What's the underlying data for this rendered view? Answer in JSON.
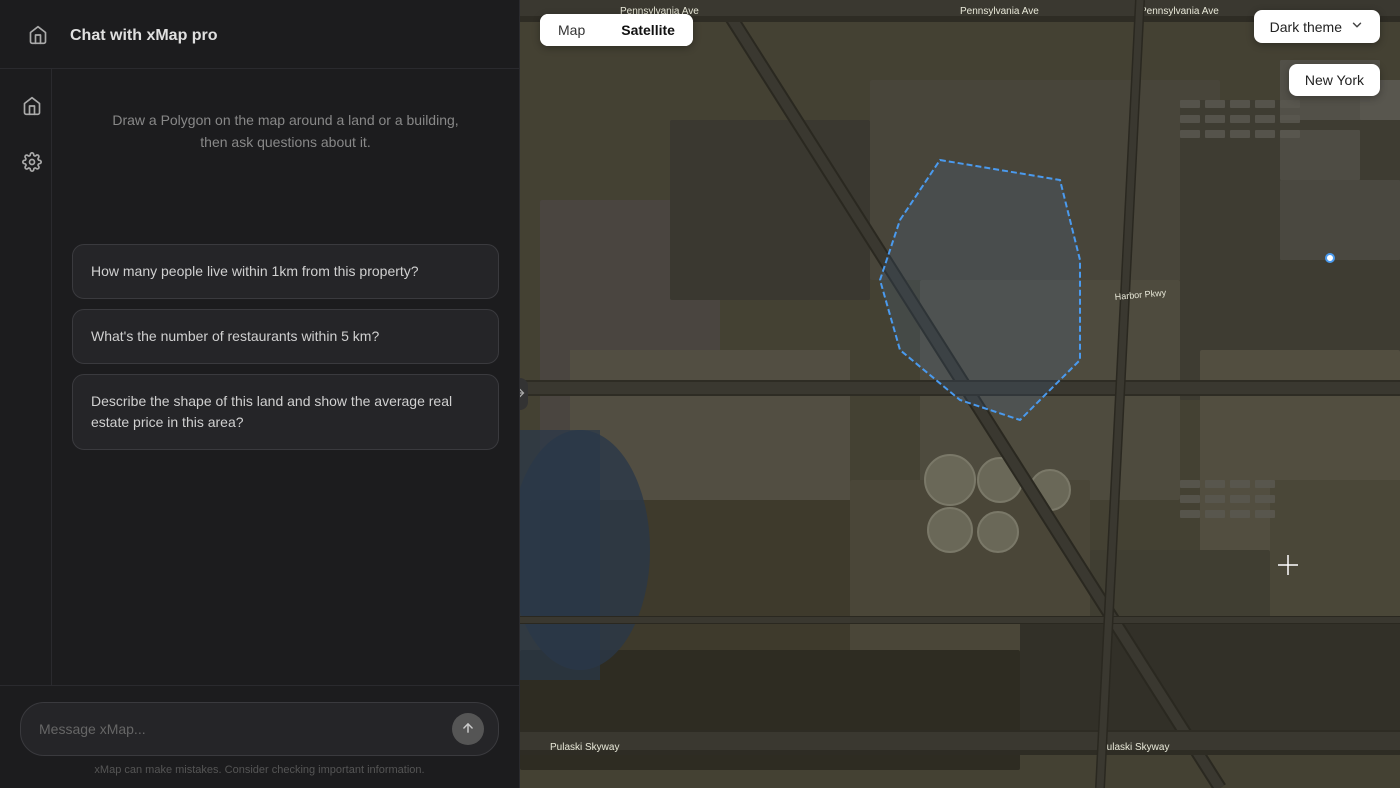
{
  "sidebar": {
    "title": "Chat with xMap pro",
    "intro_text": "Draw a Polygon on the map around a land or a building, then ask questions about it.",
    "suggestions": [
      {
        "id": "s1",
        "text": "How many people live within 1km from this property?"
      },
      {
        "id": "s2",
        "text": "What's the number of restaurants within 5 km?"
      },
      {
        "id": "s3",
        "text": "Describe the shape of this land and show the average real estate price in this area?"
      }
    ],
    "input_placeholder": "Message xMap...",
    "disclaimer": "xMap can make mistakes. Consider checking important information."
  },
  "map": {
    "tabs": [
      {
        "id": "map",
        "label": "Map",
        "active": false
      },
      {
        "id": "satellite",
        "label": "Satellite",
        "active": true
      }
    ],
    "theme_label": "Dark theme",
    "location": "New York",
    "road_labels": [
      "Pennsylvania Ave",
      "Pulaski Skyway"
    ]
  },
  "icons": {
    "home": "⌂",
    "settings": "⚙",
    "send": "↑",
    "chevron_down": "▾",
    "resize": "⇄"
  }
}
